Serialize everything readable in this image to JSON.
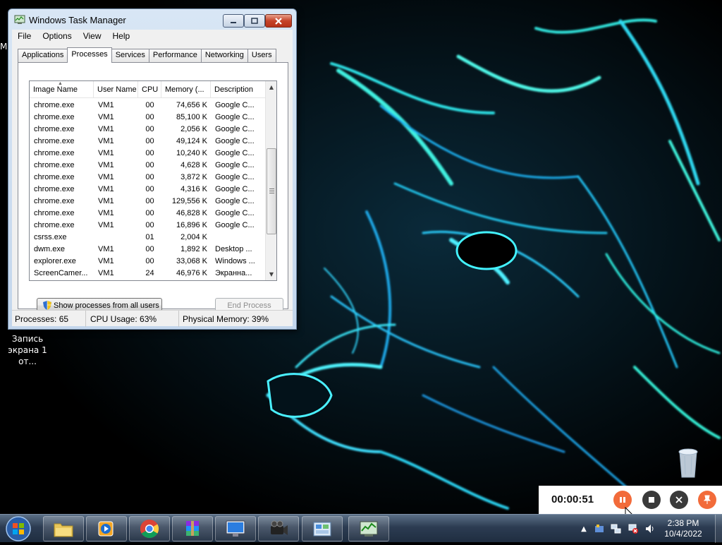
{
  "desktop": {
    "icon_recording_label_line1": "Запись",
    "icon_recording_label_line2": "экрана 1 от...",
    "icon_recycle_label": "Recycle Bin",
    "partial_left_text": "M"
  },
  "task_manager": {
    "title": "Windows Task Manager",
    "menu": [
      "File",
      "Options",
      "View",
      "Help"
    ],
    "tabs": [
      "Applications",
      "Processes",
      "Services",
      "Performance",
      "Networking",
      "Users"
    ],
    "active_tab": "Processes",
    "columns": [
      "Image Name",
      "User Name",
      "CPU",
      "Memory (...",
      "Description"
    ],
    "rows": [
      {
        "name": "chrome.exe",
        "user": "VM1",
        "cpu": "00",
        "mem": "74,656 K",
        "desc": "Google C..."
      },
      {
        "name": "chrome.exe",
        "user": "VM1",
        "cpu": "00",
        "mem": "85,100 K",
        "desc": "Google C..."
      },
      {
        "name": "chrome.exe",
        "user": "VM1",
        "cpu": "00",
        "mem": "2,056 K",
        "desc": "Google C..."
      },
      {
        "name": "chrome.exe",
        "user": "VM1",
        "cpu": "00",
        "mem": "49,124 K",
        "desc": "Google C..."
      },
      {
        "name": "chrome.exe",
        "user": "VM1",
        "cpu": "00",
        "mem": "10,240 K",
        "desc": "Google C..."
      },
      {
        "name": "chrome.exe",
        "user": "VM1",
        "cpu": "00",
        "mem": "4,628 K",
        "desc": "Google C..."
      },
      {
        "name": "chrome.exe",
        "user": "VM1",
        "cpu": "00",
        "mem": "3,872 K",
        "desc": "Google C..."
      },
      {
        "name": "chrome.exe",
        "user": "VM1",
        "cpu": "00",
        "mem": "4,316 K",
        "desc": "Google C..."
      },
      {
        "name": "chrome.exe",
        "user": "VM1",
        "cpu": "00",
        "mem": "129,556 K",
        "desc": "Google C..."
      },
      {
        "name": "chrome.exe",
        "user": "VM1",
        "cpu": "00",
        "mem": "46,828 K",
        "desc": "Google C..."
      },
      {
        "name": "chrome.exe",
        "user": "VM1",
        "cpu": "00",
        "mem": "16,896 K",
        "desc": "Google C..."
      },
      {
        "name": "csrss.exe",
        "user": "",
        "cpu": "01",
        "mem": "2,004 K",
        "desc": ""
      },
      {
        "name": "dwm.exe",
        "user": "VM1",
        "cpu": "00",
        "mem": "1,892 K",
        "desc": "Desktop ..."
      },
      {
        "name": "explorer.exe",
        "user": "VM1",
        "cpu": "00",
        "mem": "33,068 K",
        "desc": "Windows ..."
      },
      {
        "name": "ScreenCamer...",
        "user": "VM1",
        "cpu": "24",
        "mem": "46,976 K",
        "desc": "Экранна..."
      }
    ],
    "show_all_label": "Show processes from all users",
    "end_process_label": "End Process",
    "status": {
      "processes": "Processes: 65",
      "cpu": "CPU Usage: 63%",
      "memory": "Physical Memory: 39%"
    }
  },
  "recorder": {
    "elapsed": "00:00:51",
    "colors": {
      "pause": "#f26b3a",
      "stop": "#3a3a3a",
      "close": "#3a3a3a",
      "pin": "#f26b3a"
    }
  },
  "taskbar": {
    "pinned": [
      "explorer-icon",
      "media-player-icon",
      "chrome-icon",
      "winrar-icon",
      "monitor-icon",
      "camera-icon",
      "control-panel-icon",
      "task-manager-icon"
    ],
    "clock_time": "2:38 PM",
    "clock_date": "10/4/2022"
  }
}
